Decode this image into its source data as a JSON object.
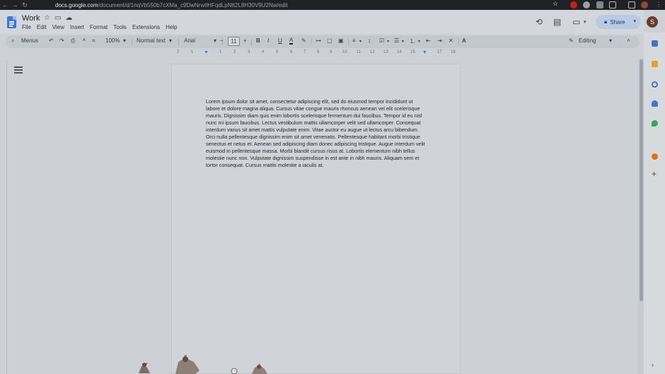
{
  "browser": {
    "url_domain": "docs.google.com",
    "url_path": "/document/d/1nqVb550b7cXMa_c9DwNrwtlHFqdLpNtt2L8H30V9U2Nw/edit"
  },
  "doc": {
    "title": "Work",
    "menus": [
      "File",
      "Edit",
      "View",
      "Insert",
      "Format",
      "Tools",
      "Extensions",
      "Help"
    ]
  },
  "header": {
    "share_label": "Share",
    "avatar_initial": "S"
  },
  "toolbar": {
    "menus_label": "Menus",
    "zoom": "100%",
    "style": "Normal text",
    "font": "Arial",
    "font_size": "11",
    "mode": "Editing",
    "minus": "−",
    "plus": "+"
  },
  "ruler": {
    "ticks": [
      "2",
      "1",
      "1",
      "2",
      "3",
      "4",
      "5",
      "6",
      "7",
      "8",
      "9",
      "10",
      "11",
      "12",
      "13",
      "14",
      "15",
      "17",
      "18"
    ]
  },
  "body_text": "Lorem ipsum dolor sit amet, consectetur adipiscing elit, sed do eiusmod tempor incididunt ut labore et dolore magna aliqua. Cursus vitae congue mauris rhoncus aenean vel elit scelerisque mauris. Dignissim diam quis enim lobortis scelerisque fermentum dui faucibus. Tempor id eu nisl nunc mi ipsum faucibus. Lectus vestibulum mattis ullamcorper velit sed ullamcorper. Consequat interdum varius sit amet mattis vulputate enim. Vitae auctor eu augue ut lectus arcu bibendum. Orci nulla pellentesque dignissim enim sit amet venenatis. Pellentesque habitant morbi tristique senectus et netus et. Aenean sed adipiscing diam donec adipiscing tristique. Augue interdum velit euismod in pellentesque massa. Morbi blandit cursus risus at. Lobortis elementum nibh tellus molestie nunc non. Vulputate dignissim suspendisse in est ante in nibh mauris. Aliquam sem et tortor consequat. Cursus mattis molestie a iaculis at.",
  "colors": {
    "accent": "#3f74d4",
    "share_bg": "#b9cbe3",
    "page_bg": "#d0d3d7"
  }
}
